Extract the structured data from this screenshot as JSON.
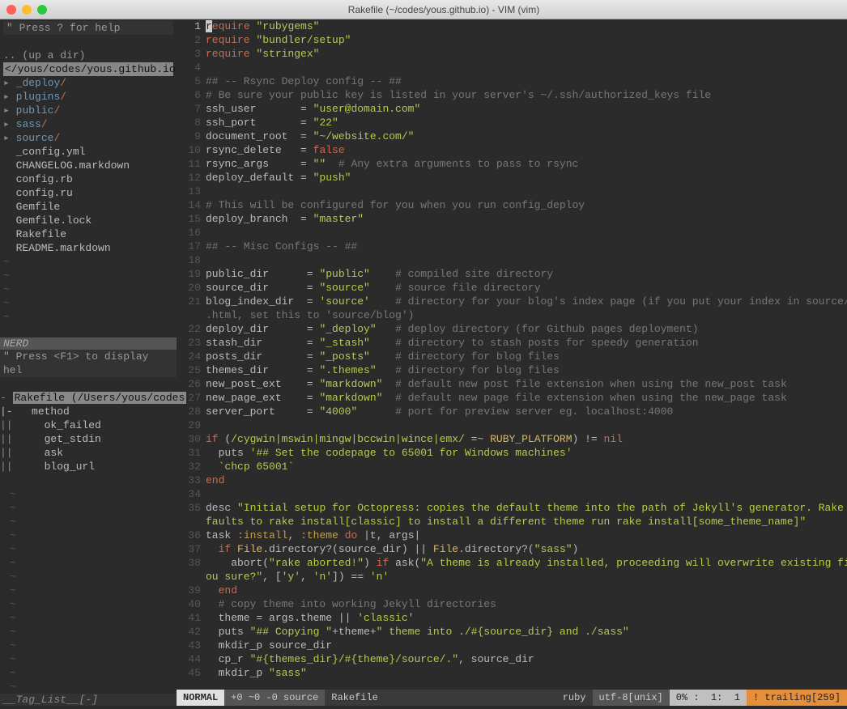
{
  "window": {
    "title": "Rakefile (~/codes/yous.github.io) - VIM (vim)"
  },
  "nerd": {
    "help": "\"  Press ? for help",
    "updir": ".. (up a dir)",
    "path": "</yous/codes/yous.github.io/",
    "dirs": [
      "_deploy",
      "plugins",
      "public",
      "sass",
      "source"
    ],
    "files": [
      "_config.yml",
      "CHANGELOG.markdown",
      "config.rb",
      "config.ru",
      "Gemfile",
      "Gemfile.lock",
      "Rakefile",
      "README.markdown"
    ],
    "status": "NERD"
  },
  "taglist": {
    "help": "\"  Press <F1> to display hel",
    "current": "Rakefile (/Users/yous/codes",
    "method_label": "method",
    "methods": [
      "ok_failed",
      "get_stdin",
      "ask",
      "blog_url"
    ],
    "status": "__Tag_List__[-]"
  },
  "code": {
    "gutter_numbers": [
      1,
      2,
      3,
      4,
      5,
      6,
      7,
      8,
      9,
      10,
      11,
      12,
      13,
      14,
      15,
      16,
      17,
      18,
      19,
      20,
      21,
      null,
      22,
      23,
      24,
      25,
      26,
      27,
      28,
      29,
      30,
      31,
      32,
      33,
      34,
      35,
      null,
      36,
      37,
      38,
      null,
      39,
      40,
      41,
      42,
      43,
      44,
      45
    ]
  },
  "status": {
    "mode": "NORMAL",
    "flags": "+0 ~0 -0 source",
    "file": "Rakefile",
    "filetype": "ruby",
    "encoding": "utf-8[unix]",
    "pct": "0% :",
    "line": "1:",
    "col": "1",
    "trailing": "! trailing[259]"
  }
}
